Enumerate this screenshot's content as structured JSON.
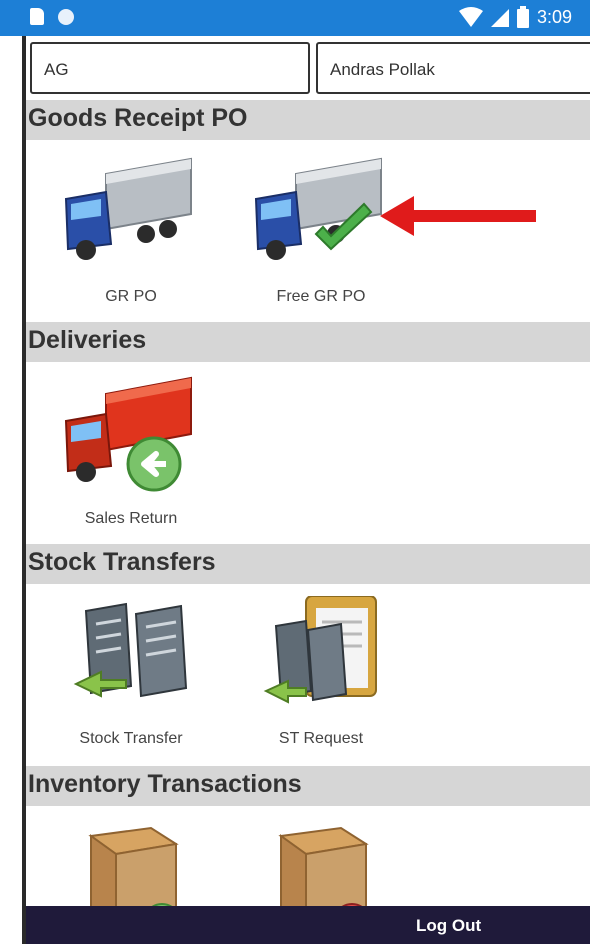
{
  "status_bar": {
    "time": "3:09",
    "icons": [
      "sd-card-icon",
      "circle-icon",
      "wifi-icon",
      "signal-icon",
      "battery-icon"
    ]
  },
  "header": {
    "field_left": "AG",
    "field_right": "Andras Pollak"
  },
  "sections": [
    {
      "title": "Goods Receipt PO",
      "items": [
        {
          "label": "GR PO",
          "icon": "truck-icon"
        },
        {
          "label": "Free GR PO",
          "icon": "truck-check-icon"
        }
      ]
    },
    {
      "title": "Deliveries",
      "items": [
        {
          "label": "Sales Return",
          "icon": "red-truck-return-icon"
        }
      ]
    },
    {
      "title": "Stock Transfers",
      "items": [
        {
          "label": "Stock Transfer",
          "icon": "servers-arrow-icon"
        },
        {
          "label": "ST Request",
          "icon": "servers-clipboard-icon"
        }
      ]
    },
    {
      "title": "Inventory Transactions",
      "items": [
        {
          "label": "",
          "icon": "crate-plus-icon"
        },
        {
          "label": "",
          "icon": "crate-minus-icon"
        }
      ]
    }
  ],
  "footer": {
    "logout_label": "Log Out"
  },
  "colors": {
    "status_bar": "#1d7fd6",
    "section_bg": "#d6d6d6",
    "footer_bg": "#1f1a3a",
    "arrow": "#e01b1b"
  }
}
